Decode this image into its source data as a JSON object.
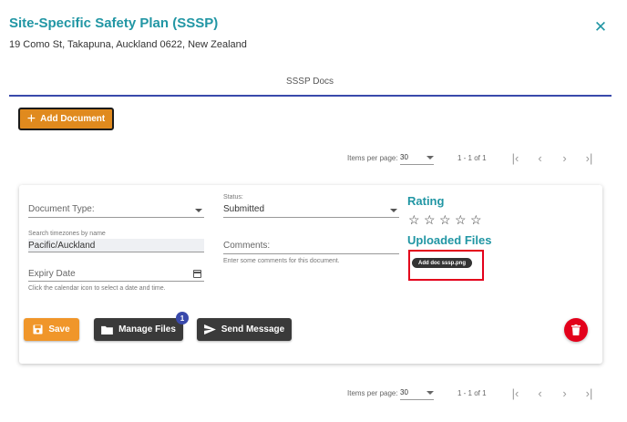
{
  "dialog": {
    "title": "Site-Specific Safety Plan (SSSP)",
    "address": "19 Como St, Takapuna, Auckland 0622, New Zealand",
    "close_icon": "close-icon"
  },
  "tabs": [
    {
      "label": "SSSP Docs",
      "active": true
    }
  ],
  "add_document_label": "Add Document",
  "pagination_top": {
    "items_per_page_label": "Items per page:",
    "items_per_page": "30",
    "range": "1 - 1 of 1"
  },
  "pagination_bottom": {
    "items_per_page_label": "Items per page:",
    "items_per_page": "30",
    "range": "1 - 1 of 1"
  },
  "document": {
    "document_type": {
      "placeholder": "Document Type:",
      "value": ""
    },
    "status": {
      "label": "Status:",
      "value": "Submitted"
    },
    "timezone": {
      "label": "Search timezones by name",
      "value": "Pacific/Auckland"
    },
    "comments": {
      "placeholder": "Comments:",
      "hint": "Enter some comments for this document.",
      "value": ""
    },
    "expiry_date": {
      "placeholder": "Expiry Date",
      "hint": "Click the calendar icon to select a date and time.",
      "value": ""
    },
    "rating": {
      "title": "Rating",
      "value": 0,
      "max": 5
    },
    "uploaded_files": {
      "title": "Uploaded Files",
      "files": [
        "Add doc sssp.png"
      ]
    },
    "buttons": {
      "save": "Save",
      "manage_files": "Manage Files",
      "manage_files_badge": "1",
      "send_message": "Send Message"
    }
  },
  "colors": {
    "accent_teal": "#2196a4",
    "tab_indicator": "#3949ab",
    "add_button": "#e08a1e",
    "save_button": "#f0962a",
    "dark_button": "#3a3a3a",
    "delete_button": "#e3001b",
    "highlight_box": "#e3001b"
  }
}
